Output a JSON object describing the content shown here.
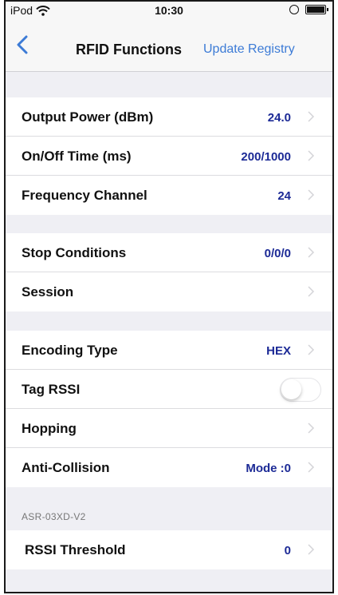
{
  "status_bar": {
    "device": "iPod",
    "time": "10:30"
  },
  "nav": {
    "title": "RFID Functions",
    "action_label": "Update Registry",
    "accent": "#3c7bd6"
  },
  "groups": [
    {
      "rows": [
        {
          "label": "Output Power (dBm)",
          "value": "24.0"
        },
        {
          "label": "On/Off Time (ms)",
          "value": "200/1000"
        },
        {
          "label": "Frequency Channel",
          "value": "24"
        }
      ]
    },
    {
      "rows": [
        {
          "label": "Stop Conditions",
          "value": "0/0/0"
        },
        {
          "label": "Session",
          "value": ""
        }
      ]
    },
    {
      "rows": [
        {
          "label": "Encoding Type",
          "value": "HEX"
        },
        {
          "label": "Tag RSSI",
          "toggle_on": false
        },
        {
          "label": "Hopping",
          "value": ""
        },
        {
          "label": "Anti-Collision",
          "value": "Mode :0"
        }
      ]
    },
    {
      "header": "ASR-03XD-V2",
      "rows": [
        {
          "label": "RSSI Threshold",
          "value": "0"
        }
      ]
    }
  ],
  "colors": {
    "value_text": "#1c2a96",
    "background": "#efeff4"
  }
}
